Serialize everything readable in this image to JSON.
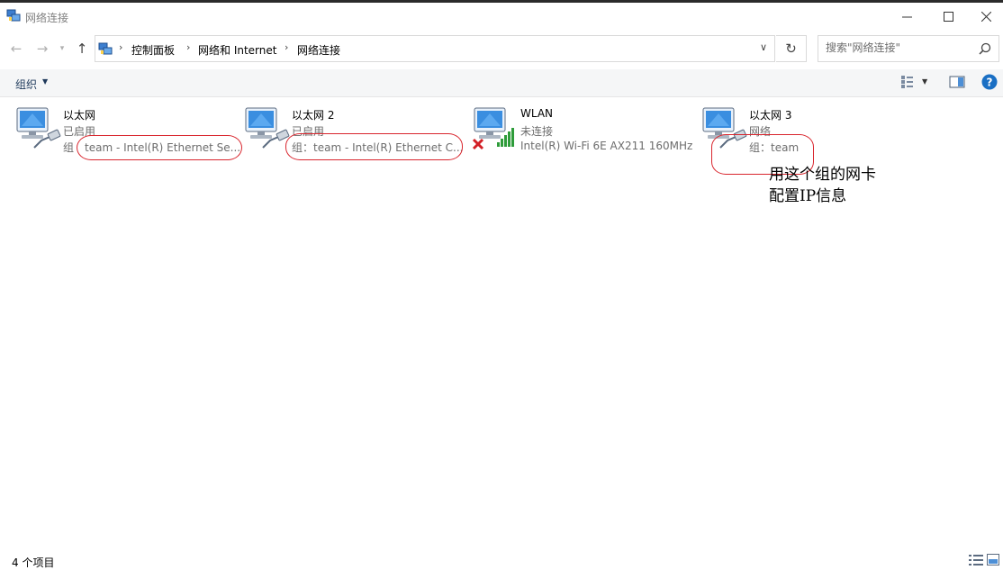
{
  "window": {
    "title": "网络连接"
  },
  "address": {
    "crumbs": [
      "控制面板",
      "网络和 Internet",
      "网络连接"
    ]
  },
  "search": {
    "placeholder": "搜索\"网络连接\""
  },
  "toolbar": {
    "organize_label": "组织"
  },
  "items": [
    {
      "name": "以太网",
      "status": "已启用",
      "device": "组　team - Intel(R) Ethernet Se...",
      "overlay": "none"
    },
    {
      "name": "以太网 2",
      "status": "已启用",
      "device": "组：team - Intel(R) Ethernet C...",
      "overlay": "none"
    },
    {
      "name": "WLAN",
      "status": "未连接",
      "device": "Intel(R) Wi-Fi 6E AX211 160MHz",
      "overlay": "disconnected-x"
    },
    {
      "name": "以太网 3",
      "status": "网络",
      "device": "组：team",
      "overlay": "none"
    }
  ],
  "annotation": {
    "note": "用这个组的网卡\n配置IP信息",
    "color": "#d9262e"
  },
  "statusbar": {
    "count_label": "4 个项目"
  },
  "colors": {
    "accent": "#1e395b",
    "help": "#1a6fc4"
  }
}
